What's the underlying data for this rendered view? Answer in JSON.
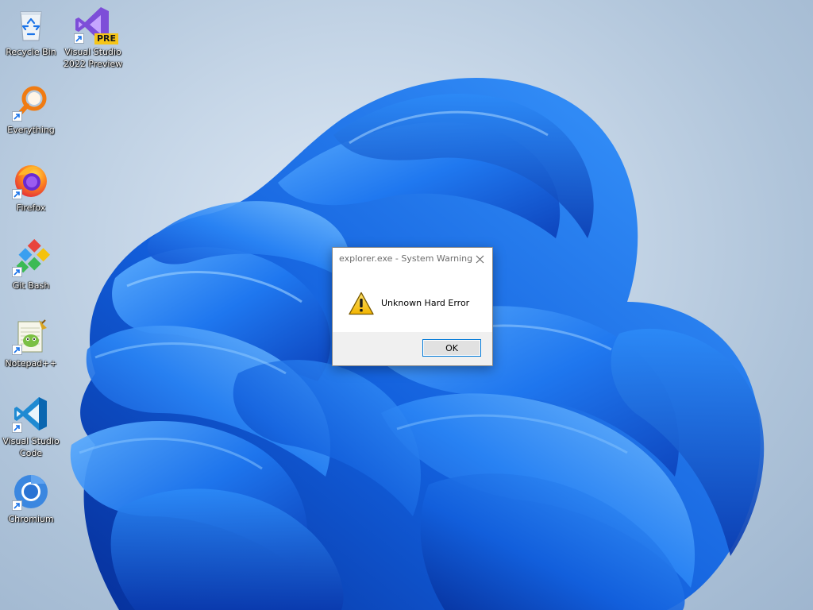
{
  "desktop": {
    "icons": [
      {
        "label": "Recycle Bin",
        "icon": "recycle-bin-icon"
      },
      {
        "label": "Visual Studio 2022 Preview",
        "icon": "visual-studio-preview-icon",
        "badge": "PRE"
      },
      {
        "label": "Everything",
        "icon": "everything-search-icon"
      },
      {
        "label": "Firefox",
        "icon": "firefox-icon"
      },
      {
        "label": "Git Bash",
        "icon": "git-bash-icon"
      },
      {
        "label": "Notepad++",
        "icon": "notepad-plus-plus-icon"
      },
      {
        "label": "Visual Studio Code",
        "icon": "vscode-icon"
      },
      {
        "label": "Chromium",
        "icon": "chromium-icon"
      }
    ]
  },
  "dialog": {
    "title": "explorer.exe - System Warning",
    "message": "Unknown Hard Error",
    "ok_label": "OK",
    "icon": "warning-icon",
    "close_icon": "close-icon"
  },
  "colors": {
    "wallpaper_bg": "#c7d7e8",
    "bloom_blue": "#1f6fe0",
    "accent": "#0078d7",
    "dialog_footer": "#f0f0f0"
  }
}
